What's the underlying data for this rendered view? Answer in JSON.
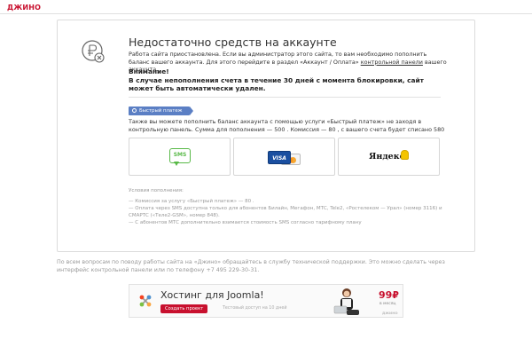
{
  "header": {
    "brand": "ДЖИНО"
  },
  "notice": {
    "title": "Недостаточно средств на аккаунте",
    "description_part1": "Работа сайта приостановлена. Если вы администратор этого сайта, то вам необходимо пополнить баланс вашего аккаунта. Для этого перейдите в раздел «Аккаунт / Оплата» ",
    "description_link": "контрольной панели",
    "description_part2": " вашего аккаунта.",
    "warning_heading": "Внимание!",
    "warning_text": "В случае непополнения счета в течение 30 дней с момента блокировки, сайт может быть автоматически удален."
  },
  "fast_payment": {
    "badge": "Быстрый платеж",
    "text": "Также вы можете пополнить баланс аккаунта с помощью услуги «Быстрый платеж» не заходя в контрольную панель. Сумма для пополнения — 500 . Комиссия — 80 , с вашего счета будет списано 580 .",
    "options": [
      {
        "label": "SMS",
        "icon": "sms-icon"
      },
      {
        "label": "VISA",
        "icon": "visa-mastercard-icon"
      },
      {
        "label": "Яндекс",
        "icon": "yandex-money-icon"
      }
    ],
    "conditions_title": "Условия пополнения:",
    "conditions": [
      "— Комиссия за услугу «Быстрый платеж» — 80 .",
      "— Оплата через SMS доступна только для абонентов Билайн, Мегафон, МТС, Tele2, «Ростелеком — Урал» (номер 3116) и СМАРТС («Теле2-GSM», номер 848).",
      "— С абонентов МТС дополнительно взимается стоимость SMS согласно тарифному плану"
    ]
  },
  "support_text": "По всем вопросам по поводу работы сайта на «Джино» обращайтесь в службу технической поддержки. Это можно сделать через интерфейс контрольной панели или по телефону +7 495 229-30-31.",
  "banner": {
    "title": "Хостинг для Joomla!",
    "button": "Создать проект",
    "note": "Тестовый доступ на 10 дней",
    "price": "99₽",
    "per": "в месяц",
    "brand": "ДЖИНО"
  },
  "colors": {
    "brand_red": "#c8102e",
    "badge_blue": "#5b7fc4",
    "sms_green": "#58b947"
  }
}
